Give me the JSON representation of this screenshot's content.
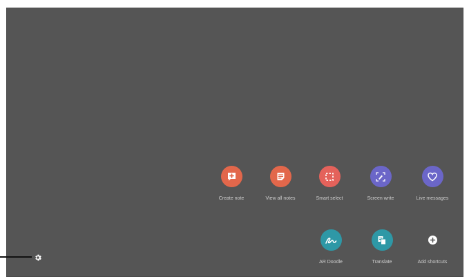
{
  "shortcuts_row1": [
    {
      "label": "Create note",
      "icon": "create-note-icon",
      "color": "#e2674b"
    },
    {
      "label": "View all notes",
      "icon": "view-notes-icon",
      "color": "#e2674b"
    },
    {
      "label": "Smart select",
      "icon": "smart-select-icon",
      "color": "#e4625b"
    },
    {
      "label": "Screen write",
      "icon": "screen-write-icon",
      "color": "#6b66c8"
    },
    {
      "label": "Live messages",
      "icon": "heart-icon",
      "color": "#6b66c8"
    }
  ],
  "shortcuts_row2": [
    {
      "label": "AR Doodle",
      "icon": "ar-doodle-icon",
      "color": "#2e98a6"
    },
    {
      "label": "Translate",
      "icon": "translate-icon",
      "color": "#2e98a6"
    },
    {
      "label": "Add shortcuts",
      "icon": "plus-icon",
      "color": "#ffffff"
    }
  ],
  "settings_icon": "gear-icon"
}
